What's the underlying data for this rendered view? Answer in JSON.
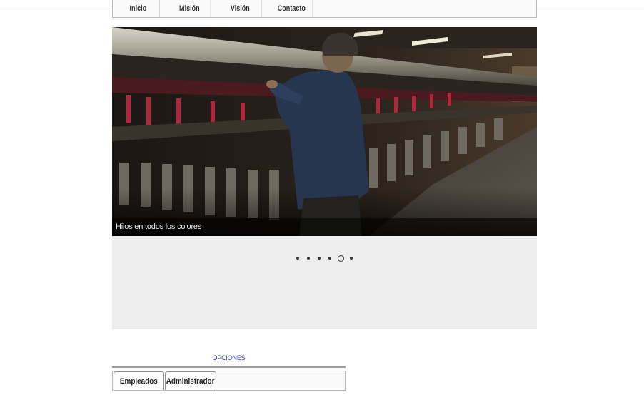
{
  "nav": {
    "items": [
      "Inicio",
      "Misión",
      "Visión",
      "Contacto"
    ]
  },
  "slider": {
    "caption": "Hilos en todos los colores",
    "dot_count": 6,
    "active_dot": 4
  },
  "options": {
    "title": "OPCIONES",
    "tabs": [
      "Empleados",
      "Administrador"
    ]
  }
}
